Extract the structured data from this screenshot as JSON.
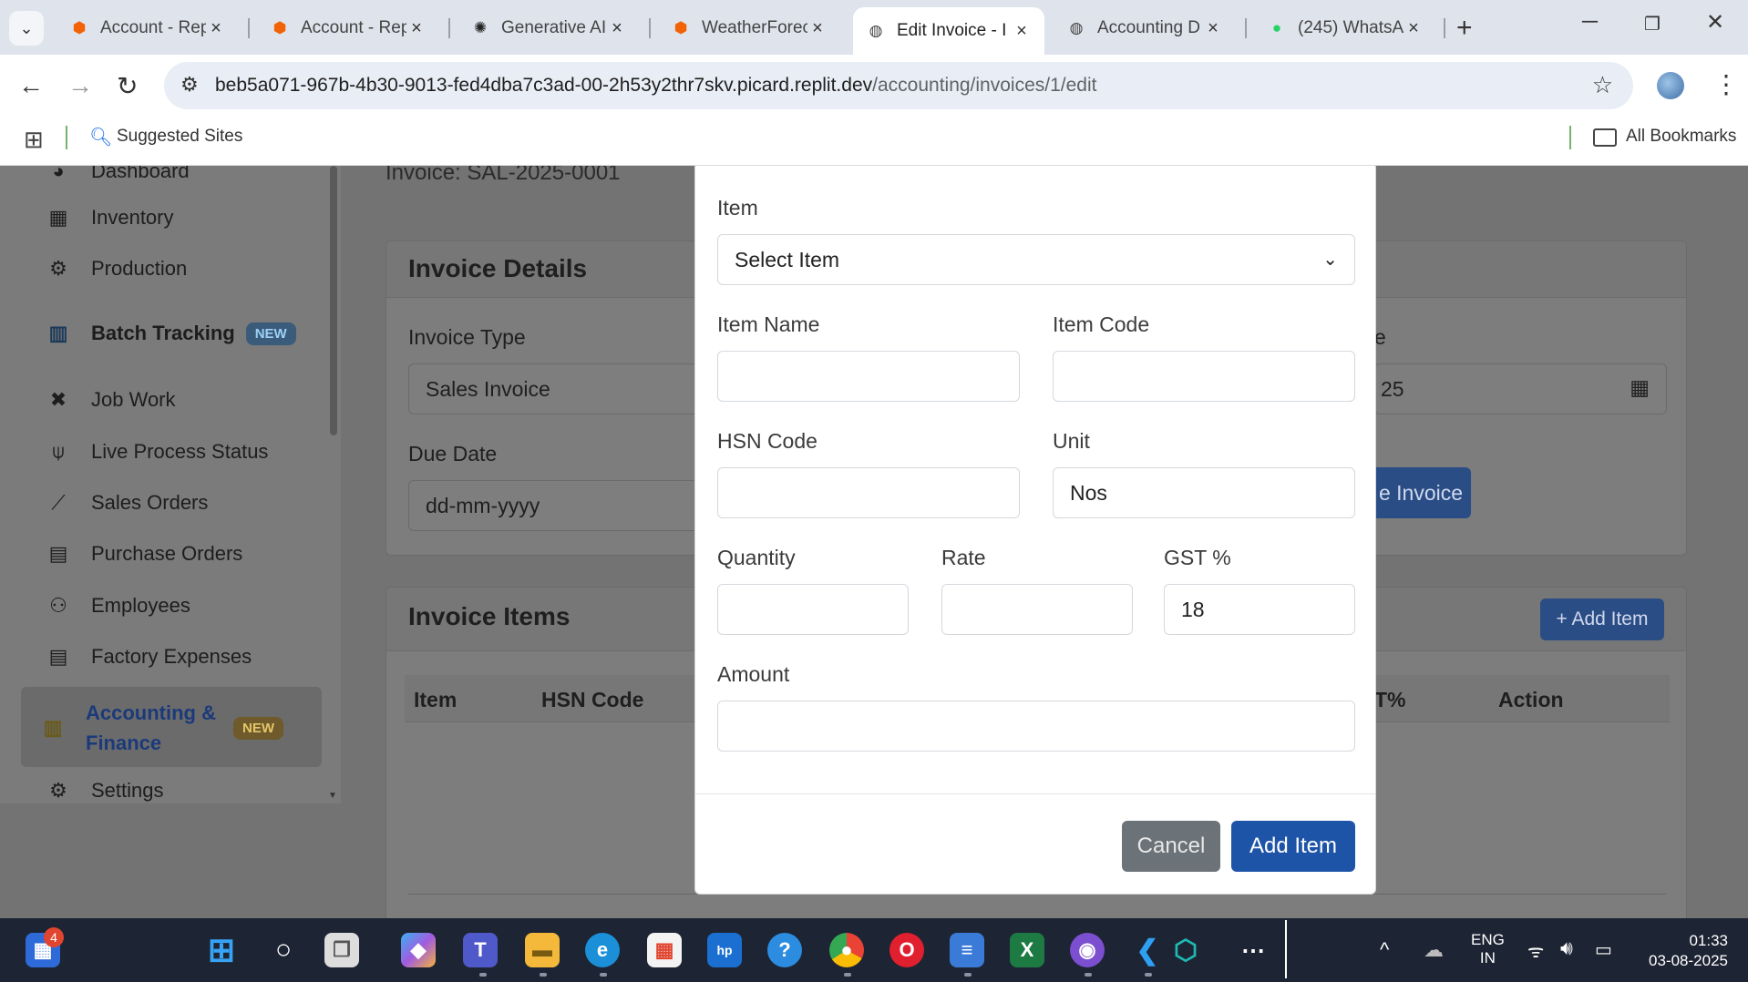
{
  "browser": {
    "tabs": [
      {
        "label": "Account - Rep",
        "icon": "replit-icon"
      },
      {
        "label": "Account - Rep",
        "icon": "replit-icon"
      },
      {
        "label": "Generative AI",
        "icon": "openai-icon"
      },
      {
        "label": "WeatherForec",
        "icon": "replit-icon"
      },
      {
        "label": "Edit Invoice - I",
        "icon": "globe-icon",
        "active": true
      },
      {
        "label": "Accounting D",
        "icon": "globe-icon"
      },
      {
        "label": "(245) WhatsAp",
        "icon": "whatsapp-icon"
      }
    ],
    "url_host": "beb5a071-967b-4b30-9013-fed4dba7c3ad-00-2h53y2thr7skv.picard.replit.dev",
    "url_path": "/accounting/invoices/1/edit",
    "bookmarks": {
      "suggested": "Suggested Sites",
      "all": "All Bookmarks"
    }
  },
  "sidebar": {
    "items": [
      {
        "label": "Dashboard",
        "icon": "dashboard-icon"
      },
      {
        "label": "Inventory",
        "icon": "boxes-icon"
      },
      {
        "label": "Production",
        "icon": "cogs-icon"
      },
      {
        "label": "Batch Tracking",
        "icon": "barcode-icon",
        "badge": "NEW"
      },
      {
        "label": "Job Work",
        "icon": "tools-icon"
      },
      {
        "label": "Live Process Status",
        "icon": "broadcast-icon"
      },
      {
        "label": "Sales Orders",
        "icon": "chart-line-icon"
      },
      {
        "label": "Purchase Orders",
        "icon": "file-icon"
      },
      {
        "label": "Employees",
        "icon": "users-icon"
      },
      {
        "label": "Factory Expenses",
        "icon": "receipt-icon"
      },
      {
        "label": "Accounting & Finance",
        "line1": "Accounting &",
        "line2": "Finance",
        "icon": "calculator-icon",
        "badge": "NEW",
        "active": true
      },
      {
        "label": "Settings",
        "icon": "gear-icon"
      }
    ]
  },
  "main": {
    "invoice_number": "Invoice: SAL-2025-0001",
    "details": {
      "title": "Invoice Details",
      "invoice_type_label": "Invoice Type",
      "invoice_type_value": "Sales Invoice",
      "due_date_label": "Due Date",
      "due_date_placeholder": "dd-mm-yyyy",
      "date_label_partial": "e",
      "date_value_partial": "25",
      "update_button_partial": "e Invoice"
    },
    "items": {
      "title": "Invoice Items",
      "add_item": "+ Add Item",
      "columns": [
        "Item",
        "HSN Code",
        "T%",
        "Action"
      ]
    }
  },
  "modal": {
    "item_label": "Item",
    "item_select": "Select Item",
    "item_name_label": "Item Name",
    "item_code_label": "Item Code",
    "hsn_label": "HSN Code",
    "unit_label": "Unit",
    "unit_value": "Nos",
    "quantity_label": "Quantity",
    "rate_label": "Rate",
    "gst_label": "GST %",
    "gst_value": "18",
    "amount_label": "Amount",
    "cancel": "Cancel",
    "add_item": "Add Item"
  },
  "taskbar": {
    "notification_count": "4",
    "lang_line1": "ENG",
    "lang_line2": "IN",
    "time": "01:33",
    "date": "03-08-2025"
  }
}
